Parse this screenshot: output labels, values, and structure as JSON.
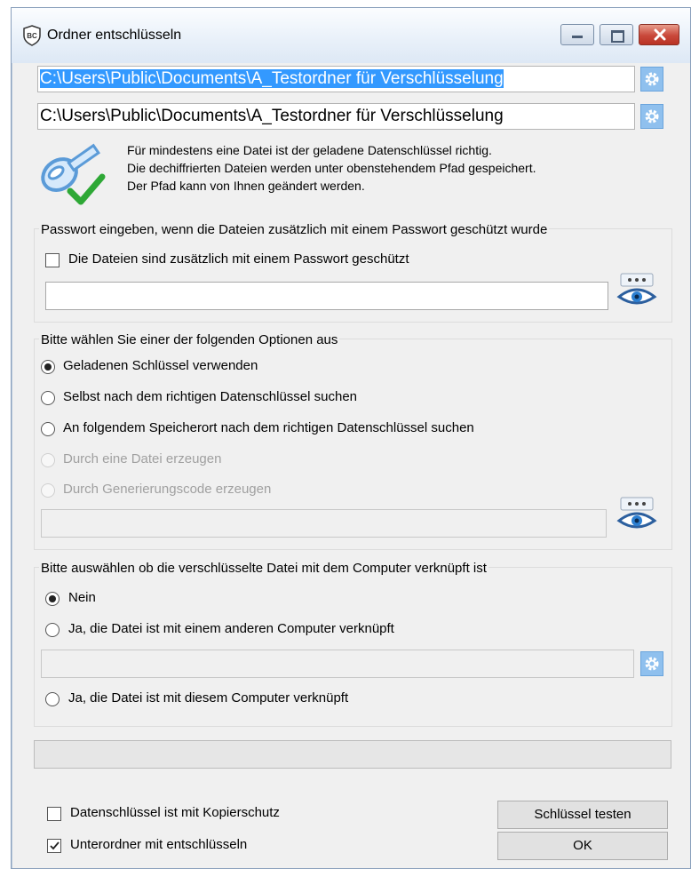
{
  "window": {
    "title": "Ordner entschlüsseln"
  },
  "paths": {
    "source": "C:\\Users\\Public\\Documents\\A_Testordner für Verschlüsselung",
    "target": "C:\\Users\\Public\\Documents\\A_Testordner für Verschlüsselung"
  },
  "info": {
    "line1": "Für mindestens eine Datei ist der geladene Datenschlüssel richtig.",
    "line2": "Die dechiffrierten Dateien werden unter obenstehendem Pfad gespeichert.",
    "line3": "Der Pfad kann von Ihnen geändert werden."
  },
  "password_group": {
    "legend": "Passwort eingeben, wenn die Dateien zusätzlich mit einem Passwort geschützt wurde",
    "checkbox_label": "Die Dateien sind zusätzlich mit einem Passwort geschützt",
    "checked": false
  },
  "options_group": {
    "legend": "Bitte wählen Sie einer der folgenden Optionen aus",
    "options": [
      {
        "label": "Geladenen Schlüssel verwenden",
        "selected": true,
        "enabled": true
      },
      {
        "label": "Selbst nach dem richtigen Datenschlüssel suchen",
        "selected": false,
        "enabled": true
      },
      {
        "label": "An folgendem Speicherort nach dem richtigen Datenschlüssel suchen",
        "selected": false,
        "enabled": true
      },
      {
        "label": "Durch eine Datei erzeugen",
        "selected": false,
        "enabled": false
      },
      {
        "label": "Durch Generierungscode erzeugen",
        "selected": false,
        "enabled": false
      }
    ]
  },
  "computer_group": {
    "legend": "Bitte auswählen ob die verschlüsselte Datei mit dem Computer verknüpft ist",
    "options": [
      {
        "label": "Nein",
        "selected": true
      },
      {
        "label": "Ja, die Datei ist mit einem anderen Computer verknüpft",
        "selected": false
      },
      {
        "label": "Ja, die Datei ist mit diesem Computer verknüpft",
        "selected": false
      }
    ]
  },
  "footer": {
    "copy_protection_label": "Datenschlüssel ist mit Kopierschutz",
    "copy_protection_checked": false,
    "subfolders_label": "Unterordner mit entschlüsseln",
    "subfolders_checked": true,
    "test_button": "Schlüssel testen",
    "ok_button": "OK"
  },
  "icons": [
    "app-shield-icon",
    "minimize-icon",
    "maximize-icon",
    "close-icon",
    "gear-icon",
    "key-check-icon",
    "eye-icon"
  ],
  "colors": {
    "selection": "#3399ff",
    "gear": "#8fc0ee",
    "close": "#c9483a"
  }
}
